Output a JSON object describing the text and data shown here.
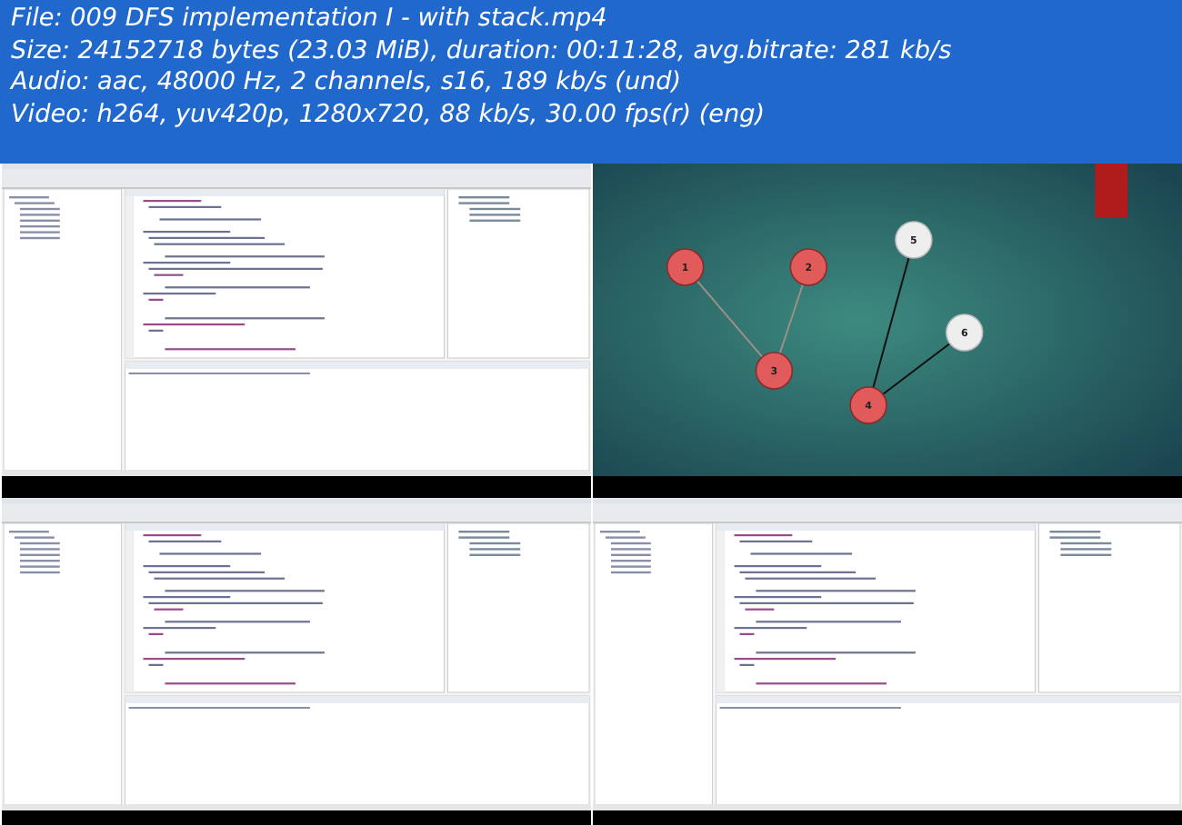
{
  "info_lines": [
    "File: 009 DFS implementation I - with stack.mp4",
    "Size: 24152718 bytes (23.03 MiB), duration: 00:11:28, avg.bitrate: 281 kb/s",
    "Audio: aac, 48000 Hz, 2 channels, s16, 189 kb/s (und)",
    "Video: h264, yuv420p, 1280x720, 88 kb/s, 30.00 fps(r) (eng)"
  ],
  "frames": [
    {
      "kind": "ide"
    },
    {
      "kind": "graph",
      "nodes": [
        {
          "label": "1",
          "visited": true
        },
        {
          "label": "2",
          "visited": true
        },
        {
          "label": "3",
          "visited": true
        },
        {
          "label": "4",
          "visited": true
        },
        {
          "label": "5",
          "visited": false
        },
        {
          "label": "6",
          "visited": false
        }
      ],
      "edges": [
        {
          "visited": true
        },
        {
          "visited": true
        },
        {
          "visited": false
        },
        {
          "visited": false
        }
      ]
    },
    {
      "kind": "ide"
    },
    {
      "kind": "ide"
    }
  ]
}
